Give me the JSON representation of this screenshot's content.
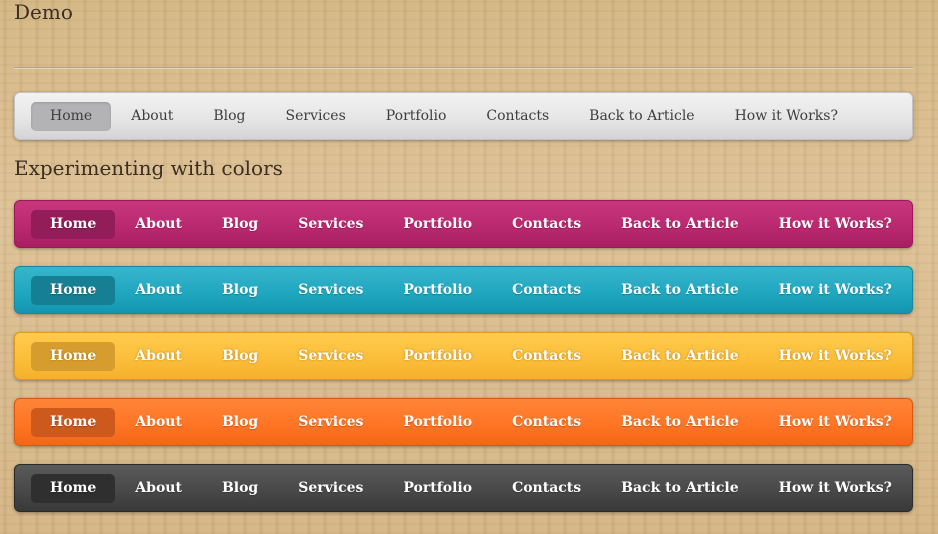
{
  "page": {
    "demo_title": "Demo",
    "section_title": "Experimenting with colors"
  },
  "nav_items": [
    "Home",
    "About",
    "Blog",
    "Services",
    "Portfolio",
    "Contacts",
    "Back to Article",
    "How it Works?"
  ],
  "active_item": "Home",
  "bars": [
    {
      "id": "gray",
      "color": "#e4e4e5",
      "active_color": "#b3b3b5"
    },
    {
      "id": "pink",
      "color": "#b8286e",
      "active_color": "#921d58"
    },
    {
      "id": "teal",
      "color": "#1ea6bf",
      "active_color": "#167f93"
    },
    {
      "id": "yellow",
      "color": "#fbbd39",
      "active_color": "#d69d2e"
    },
    {
      "id": "orange",
      "color": "#ff7423",
      "active_color": "#cd5a1c"
    },
    {
      "id": "dark",
      "color": "#474747",
      "active_color": "#2f2f2f"
    }
  ]
}
